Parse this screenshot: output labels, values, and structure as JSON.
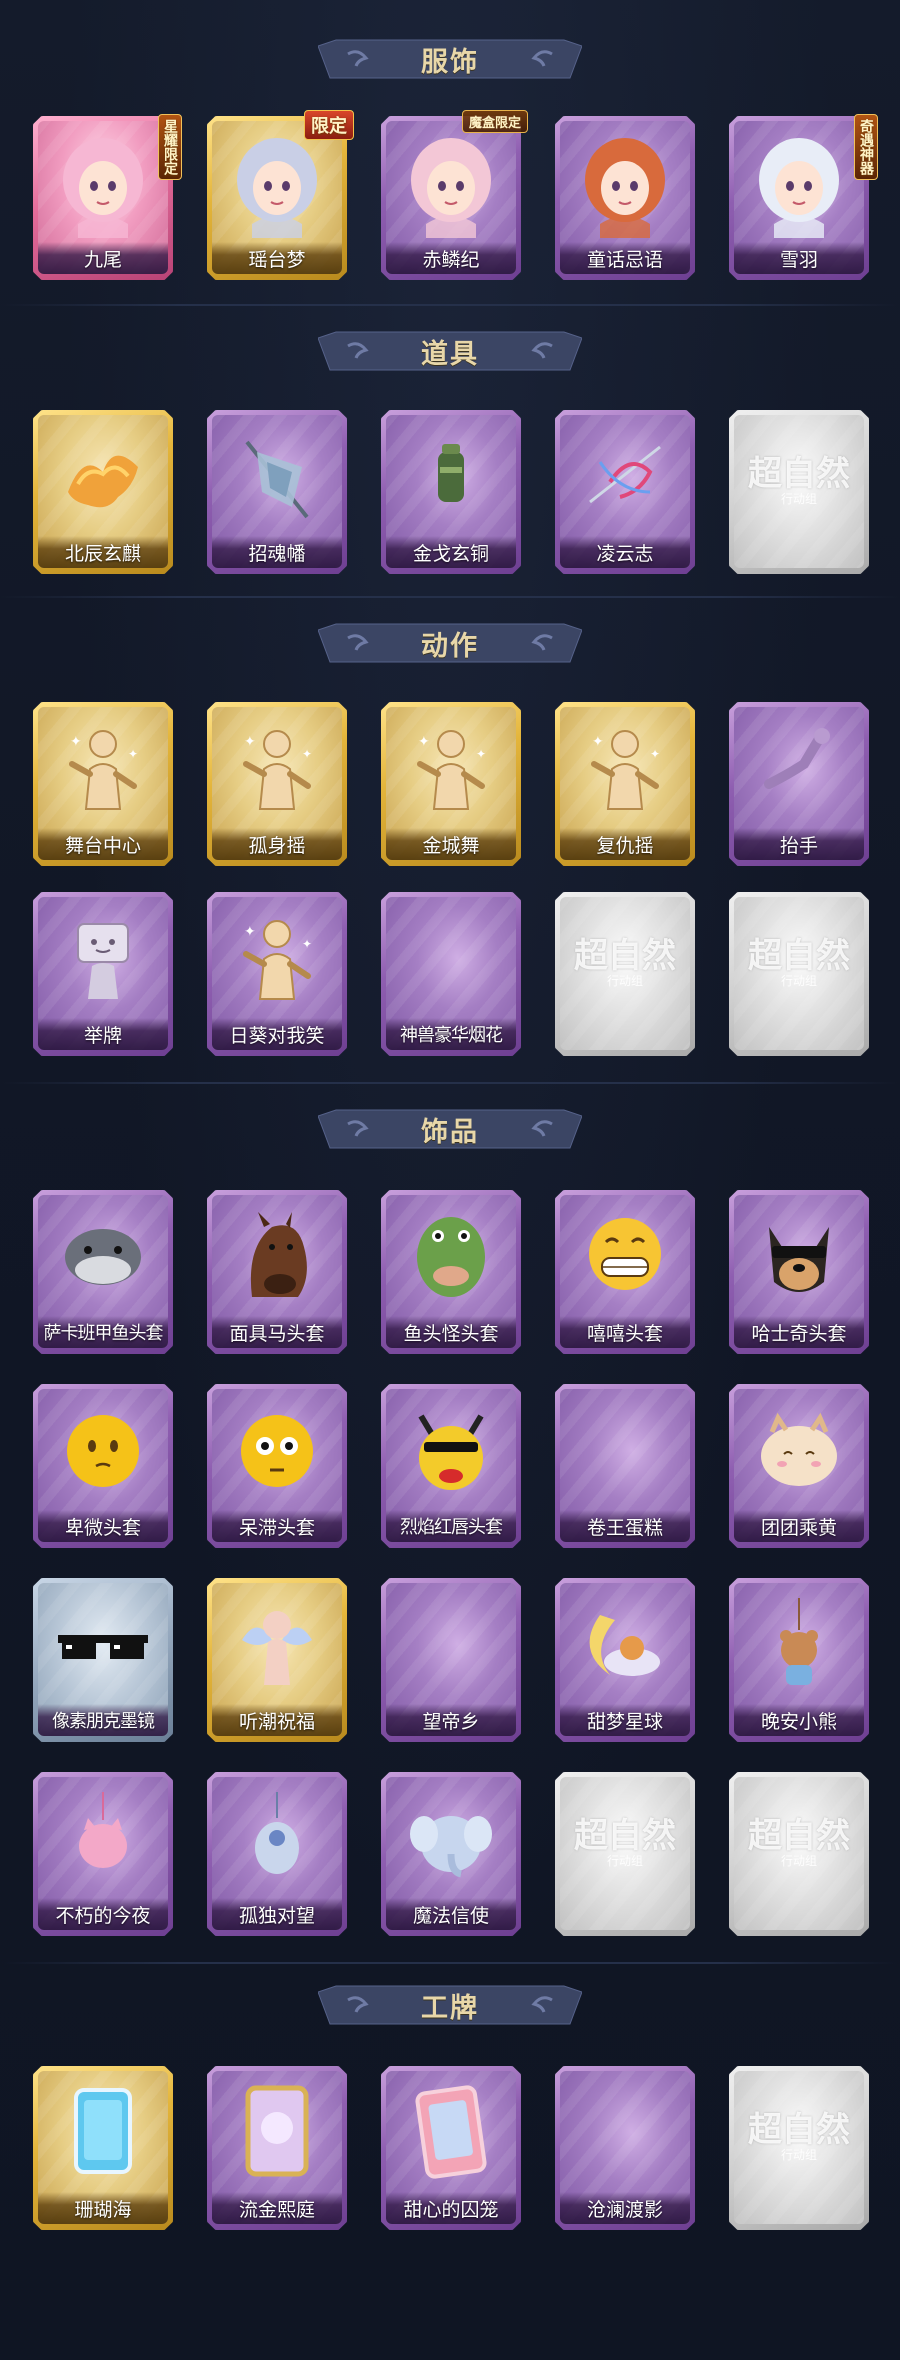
{
  "sections": [
    {
      "title": "服饰",
      "items": [
        {
          "label": "九尾",
          "style": "pink",
          "icon": "fox-girl-portrait-icon",
          "badge": "星耀限定"
        },
        {
          "label": "瑶台梦",
          "style": "gold",
          "icon": "silver-hair-portrait-icon",
          "badge": "限定"
        },
        {
          "label": "赤鳞纪",
          "style": "purple",
          "icon": "dragon-girl-portrait-icon",
          "badge": "魔盒限定"
        },
        {
          "label": "童话忌语",
          "style": "purple",
          "icon": "red-hair-girl-portrait-icon",
          "badge": ""
        },
        {
          "label": "雪羽",
          "style": "purple",
          "icon": "white-hair-portrait-icon",
          "badge": "奇遇神器"
        }
      ]
    },
    {
      "title": "道具",
      "items": [
        {
          "label": "北辰玄麒",
          "style": "gold",
          "icon": "golden-qilin-icon"
        },
        {
          "label": "招魂幡",
          "style": "purple",
          "icon": "banner-flag-icon"
        },
        {
          "label": "金戈玄铜",
          "style": "purple",
          "icon": "bronze-lantern-icon"
        },
        {
          "label": "凌云志",
          "style": "purple",
          "icon": "ribbon-sword-icon"
        },
        {
          "label": "",
          "style": "gray",
          "icon": "placeholder-logo-icon"
        }
      ]
    },
    {
      "title": "动作",
      "items": [
        {
          "label": "舞台中心",
          "style": "gold",
          "icon": "pose-figure-icon"
        },
        {
          "label": "孤身摇",
          "style": "gold",
          "icon": "pose-figure-icon"
        },
        {
          "label": "金城舞",
          "style": "gold",
          "icon": "pose-figure-icon"
        },
        {
          "label": "复仇摇",
          "style": "gold",
          "icon": "pose-figure-icon"
        },
        {
          "label": "抬手",
          "style": "purple",
          "icon": "raise-hand-icon"
        },
        {
          "label": "举牌",
          "style": "purple",
          "icon": "hold-sign-icon"
        },
        {
          "label": "日葵对我笑",
          "style": "purple",
          "icon": "pose-figure-icon"
        },
        {
          "label": "神兽豪华烟花",
          "style": "purple",
          "icon": "fireworks-icon"
        },
        {
          "label": "",
          "style": "gray",
          "icon": "placeholder-logo-icon"
        },
        {
          "label": "",
          "style": "gray",
          "icon": "placeholder-logo-icon"
        }
      ]
    },
    {
      "title": "饰品",
      "items": [
        {
          "label": "萨卡班甲鱼头套",
          "style": "purple",
          "icon": "fish-head-icon"
        },
        {
          "label": "面具马头套",
          "style": "purple",
          "icon": "horse-head-icon"
        },
        {
          "label": "鱼头怪头套",
          "style": "purple",
          "icon": "frog-fish-head-icon"
        },
        {
          "label": "嘻嘻头套",
          "style": "purple",
          "icon": "grin-emoji-icon"
        },
        {
          "label": "哈士奇头套",
          "style": "purple",
          "icon": "husky-head-icon"
        },
        {
          "label": "卑微头套",
          "style": "purple",
          "icon": "shy-emoji-icon"
        },
        {
          "label": "呆滞头套",
          "style": "purple",
          "icon": "dazed-emoji-icon"
        },
        {
          "label": "烈焰红唇头套",
          "style": "purple",
          "icon": "pikachu-lips-icon"
        },
        {
          "label": "卷王蛋糕",
          "style": "purple",
          "icon": "cake-icon"
        },
        {
          "label": "团团乘黄",
          "style": "purple",
          "icon": "fluffy-creature-icon"
        },
        {
          "label": "像素朋克墨镜",
          "style": "blue",
          "icon": "pixel-sunglasses-icon"
        },
        {
          "label": "听潮祝福",
          "style": "gold",
          "icon": "wing-doll-icon"
        },
        {
          "label": "望帝乡",
          "style": "purple",
          "icon": "empty-icon"
        },
        {
          "label": "甜梦星球",
          "style": "purple",
          "icon": "moon-bear-icon"
        },
        {
          "label": "晚安小熊",
          "style": "purple",
          "icon": "bear-charm-icon"
        },
        {
          "label": "不朽的今夜",
          "style": "purple",
          "icon": "pink-cat-charm-icon"
        },
        {
          "label": "孤独对望",
          "style": "purple",
          "icon": "blue-charm-icon"
        },
        {
          "label": "魔法信使",
          "style": "purple",
          "icon": "elephant-icon"
        },
        {
          "label": "",
          "style": "gray",
          "icon": "placeholder-logo-icon"
        },
        {
          "label": "",
          "style": "gray",
          "icon": "placeholder-logo-icon"
        }
      ]
    },
    {
      "title": "工牌",
      "items": [
        {
          "label": "珊瑚海",
          "style": "gold",
          "icon": "blue-card-icon"
        },
        {
          "label": "流金熙庭",
          "style": "purple",
          "icon": "gold-frame-card-icon"
        },
        {
          "label": "甜心的囚笼",
          "style": "purple",
          "icon": "pink-card-icon"
        },
        {
          "label": "沧澜渡影",
          "style": "purple",
          "icon": "empty-icon"
        },
        {
          "label": "",
          "style": "gray",
          "icon": "placeholder-logo-icon"
        }
      ]
    }
  ],
  "placeholder": {
    "title": "超自然",
    "subtitle": "行动组"
  }
}
